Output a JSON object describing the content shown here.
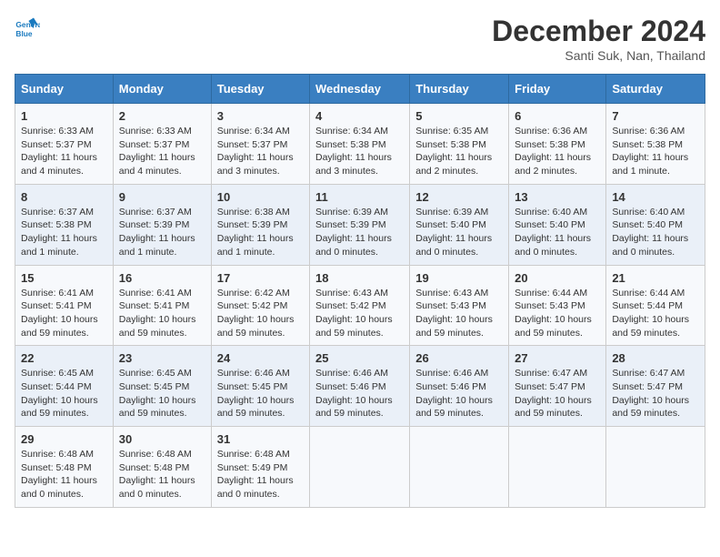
{
  "header": {
    "logo_line1": "General",
    "logo_line2": "Blue",
    "month": "December 2024",
    "location": "Santi Suk, Nan, Thailand"
  },
  "days_of_week": [
    "Sunday",
    "Monday",
    "Tuesday",
    "Wednesday",
    "Thursday",
    "Friday",
    "Saturday"
  ],
  "weeks": [
    [
      {
        "day": "1",
        "sunrise": "6:33 AM",
        "sunset": "5:37 PM",
        "daylight": "11 hours and 4 minutes."
      },
      {
        "day": "2",
        "sunrise": "6:33 AM",
        "sunset": "5:37 PM",
        "daylight": "11 hours and 4 minutes."
      },
      {
        "day": "3",
        "sunrise": "6:34 AM",
        "sunset": "5:37 PM",
        "daylight": "11 hours and 3 minutes."
      },
      {
        "day": "4",
        "sunrise": "6:34 AM",
        "sunset": "5:38 PM",
        "daylight": "11 hours and 3 minutes."
      },
      {
        "day": "5",
        "sunrise": "6:35 AM",
        "sunset": "5:38 PM",
        "daylight": "11 hours and 2 minutes."
      },
      {
        "day": "6",
        "sunrise": "6:36 AM",
        "sunset": "5:38 PM",
        "daylight": "11 hours and 2 minutes."
      },
      {
        "day": "7",
        "sunrise": "6:36 AM",
        "sunset": "5:38 PM",
        "daylight": "11 hours and 1 minute."
      }
    ],
    [
      {
        "day": "8",
        "sunrise": "6:37 AM",
        "sunset": "5:38 PM",
        "daylight": "11 hours and 1 minute."
      },
      {
        "day": "9",
        "sunrise": "6:37 AM",
        "sunset": "5:39 PM",
        "daylight": "11 hours and 1 minute."
      },
      {
        "day": "10",
        "sunrise": "6:38 AM",
        "sunset": "5:39 PM",
        "daylight": "11 hours and 1 minute."
      },
      {
        "day": "11",
        "sunrise": "6:39 AM",
        "sunset": "5:39 PM",
        "daylight": "11 hours and 0 minutes."
      },
      {
        "day": "12",
        "sunrise": "6:39 AM",
        "sunset": "5:40 PM",
        "daylight": "11 hours and 0 minutes."
      },
      {
        "day": "13",
        "sunrise": "6:40 AM",
        "sunset": "5:40 PM",
        "daylight": "11 hours and 0 minutes."
      },
      {
        "day": "14",
        "sunrise": "6:40 AM",
        "sunset": "5:40 PM",
        "daylight": "11 hours and 0 minutes."
      }
    ],
    [
      {
        "day": "15",
        "sunrise": "6:41 AM",
        "sunset": "5:41 PM",
        "daylight": "10 hours and 59 minutes."
      },
      {
        "day": "16",
        "sunrise": "6:41 AM",
        "sunset": "5:41 PM",
        "daylight": "10 hours and 59 minutes."
      },
      {
        "day": "17",
        "sunrise": "6:42 AM",
        "sunset": "5:42 PM",
        "daylight": "10 hours and 59 minutes."
      },
      {
        "day": "18",
        "sunrise": "6:43 AM",
        "sunset": "5:42 PM",
        "daylight": "10 hours and 59 minutes."
      },
      {
        "day": "19",
        "sunrise": "6:43 AM",
        "sunset": "5:43 PM",
        "daylight": "10 hours and 59 minutes."
      },
      {
        "day": "20",
        "sunrise": "6:44 AM",
        "sunset": "5:43 PM",
        "daylight": "10 hours and 59 minutes."
      },
      {
        "day": "21",
        "sunrise": "6:44 AM",
        "sunset": "5:44 PM",
        "daylight": "10 hours and 59 minutes."
      }
    ],
    [
      {
        "day": "22",
        "sunrise": "6:45 AM",
        "sunset": "5:44 PM",
        "daylight": "10 hours and 59 minutes."
      },
      {
        "day": "23",
        "sunrise": "6:45 AM",
        "sunset": "5:45 PM",
        "daylight": "10 hours and 59 minutes."
      },
      {
        "day": "24",
        "sunrise": "6:46 AM",
        "sunset": "5:45 PM",
        "daylight": "10 hours and 59 minutes."
      },
      {
        "day": "25",
        "sunrise": "6:46 AM",
        "sunset": "5:46 PM",
        "daylight": "10 hours and 59 minutes."
      },
      {
        "day": "26",
        "sunrise": "6:46 AM",
        "sunset": "5:46 PM",
        "daylight": "10 hours and 59 minutes."
      },
      {
        "day": "27",
        "sunrise": "6:47 AM",
        "sunset": "5:47 PM",
        "daylight": "10 hours and 59 minutes."
      },
      {
        "day": "28",
        "sunrise": "6:47 AM",
        "sunset": "5:47 PM",
        "daylight": "10 hours and 59 minutes."
      }
    ],
    [
      {
        "day": "29",
        "sunrise": "6:48 AM",
        "sunset": "5:48 PM",
        "daylight": "11 hours and 0 minutes."
      },
      {
        "day": "30",
        "sunrise": "6:48 AM",
        "sunset": "5:48 PM",
        "daylight": "11 hours and 0 minutes."
      },
      {
        "day": "31",
        "sunrise": "6:48 AM",
        "sunset": "5:49 PM",
        "daylight": "11 hours and 0 minutes."
      },
      null,
      null,
      null,
      null
    ]
  ]
}
